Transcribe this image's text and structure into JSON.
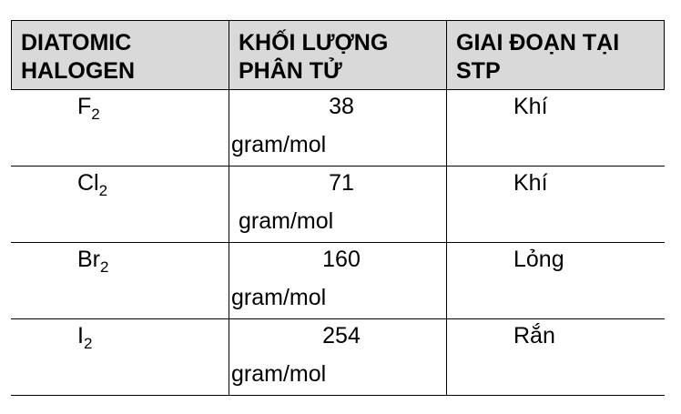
{
  "header": {
    "col1": "DIATOMIC\nHALOGEN",
    "col2": "KHỐI LƯỢNG\nPHÂN TỬ",
    "col3": "GIAI ĐOẠN TẠI\nSTP"
  },
  "rows": [
    {
      "element": "F",
      "subscript": "2",
      "mass": "38",
      "unit": "gram/mol",
      "phase": "Khí"
    },
    {
      "element": "Cl",
      "subscript": "2",
      "mass": "71",
      "unit": "gram/mol",
      "phase": "Khí"
    },
    {
      "element": "Br",
      "subscript": "2",
      "mass": "160",
      "unit": "gram/mol",
      "phase": "Lỏng"
    },
    {
      "element": "I",
      "subscript": "2",
      "mass": "254",
      "unit": "gram/mol",
      "phase": "Rắn"
    }
  ]
}
